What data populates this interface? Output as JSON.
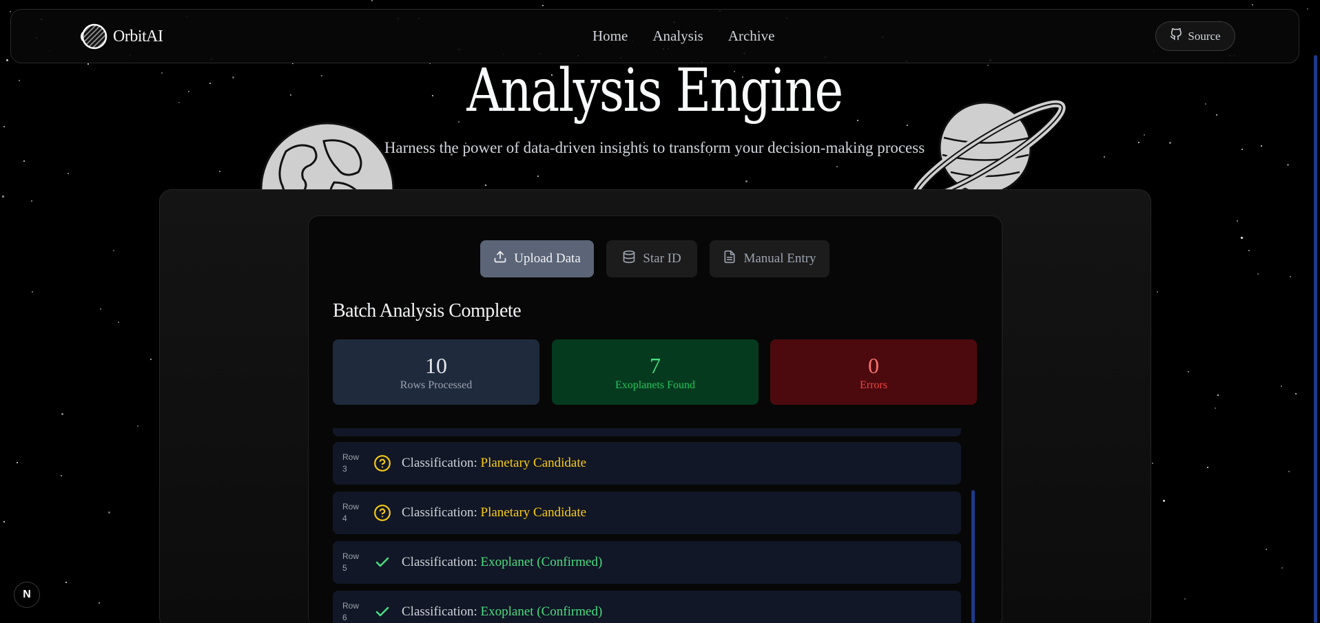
{
  "brand": {
    "name": "OrbitAI"
  },
  "nav": {
    "links": [
      "Home",
      "Analysis",
      "Archive"
    ],
    "source_label": "Source"
  },
  "hero": {
    "title": "Analysis Engine",
    "subtitle": "Harness the power of data-driven insights to transform your decision-making process"
  },
  "tabs": [
    {
      "label": "Upload Data",
      "icon": "upload-icon",
      "active": true
    },
    {
      "label": "Star ID",
      "icon": "database-icon",
      "active": false
    },
    {
      "label": "Manual Entry",
      "icon": "document-icon",
      "active": false
    }
  ],
  "batch": {
    "title": "Batch Analysis Complete",
    "stats": [
      {
        "value": "10",
        "label": "Rows Processed"
      },
      {
        "value": "7",
        "label": "Exoplanets Found"
      },
      {
        "value": "0",
        "label": "Errors"
      }
    ]
  },
  "results": [
    {
      "row_label": "Row",
      "row_num": "3",
      "prefix": "Classification:",
      "classification": "Planetary Candidate",
      "kind": "candidate",
      "icon": "question-circle-icon"
    },
    {
      "row_label": "Row",
      "row_num": "4",
      "prefix": "Classification:",
      "classification": "Planetary Candidate",
      "kind": "candidate",
      "icon": "question-circle-icon"
    },
    {
      "row_label": "Row",
      "row_num": "5",
      "prefix": "Classification:",
      "classification": "Exoplanet (Confirmed)",
      "kind": "confirmed",
      "icon": "check-icon"
    },
    {
      "row_label": "Row",
      "row_num": "6",
      "prefix": "Classification:",
      "classification": "Exoplanet (Confirmed)",
      "kind": "confirmed",
      "icon": "check-icon"
    }
  ],
  "colors": {
    "candidate": "#facc15",
    "confirmed": "#4ade80",
    "active_tab": "#5b6577"
  },
  "badge": {
    "letter": "N"
  }
}
